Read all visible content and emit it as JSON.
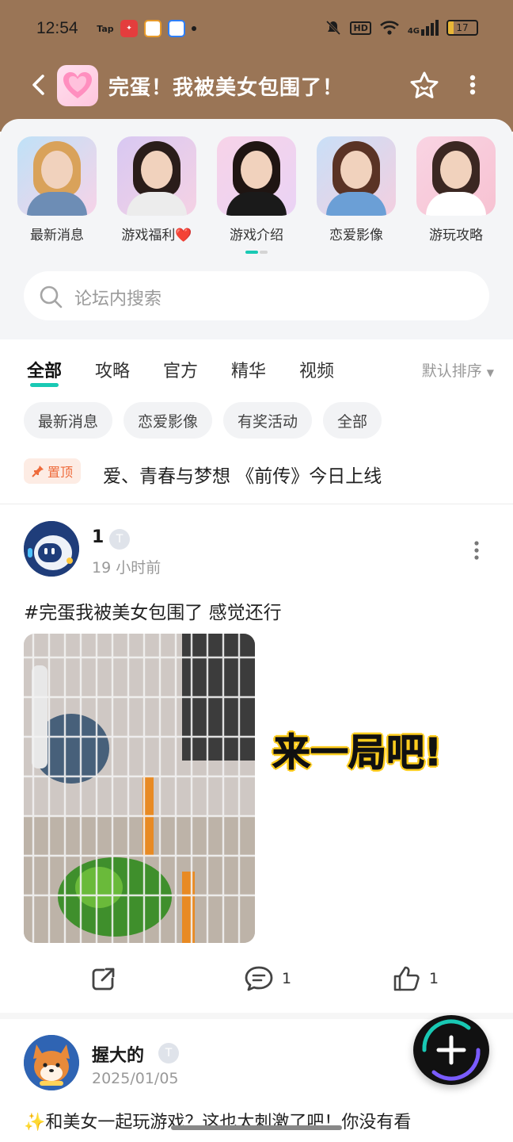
{
  "status_bar": {
    "time": "12:54",
    "hd_label": "HD",
    "network_label": "4G",
    "battery": "17"
  },
  "header": {
    "title": "完蛋！我被美女包围了！"
  },
  "categories": [
    {
      "label": "最新消息"
    },
    {
      "label": "游戏福利❤️"
    },
    {
      "label": "游戏介绍"
    },
    {
      "label": "恋爱影像"
    },
    {
      "label": "游玩攻略"
    }
  ],
  "search": {
    "placeholder": "论坛内搜索"
  },
  "tabs": [
    {
      "label": "全部",
      "active": true
    },
    {
      "label": "攻略"
    },
    {
      "label": "官方"
    },
    {
      "label": "精华"
    },
    {
      "label": "视频"
    }
  ],
  "sort_label": "默认排序",
  "filters": [
    "最新消息",
    "恋爱影像",
    "有奖活动",
    "全部"
  ],
  "pinned": {
    "badge": "置顶",
    "text": "爱、青春与梦想 《前传》今日上线"
  },
  "posts": [
    {
      "user": "1",
      "level_badge": "T",
      "time": "19 小时前",
      "text": "#完蛋我被美女包围了 感觉还行",
      "overlay": "来一局吧!",
      "comments": "1",
      "likes": "1"
    },
    {
      "user": "握大的",
      "level_badge": "T",
      "time": "2025/01/05",
      "text": "✨和美女一起玩游戏？这也太刺激了吧！你没有看"
    }
  ],
  "colors": {
    "header_bg": "#9a7556",
    "accent": "#19c9b4",
    "pin": "#ee6a3a"
  }
}
